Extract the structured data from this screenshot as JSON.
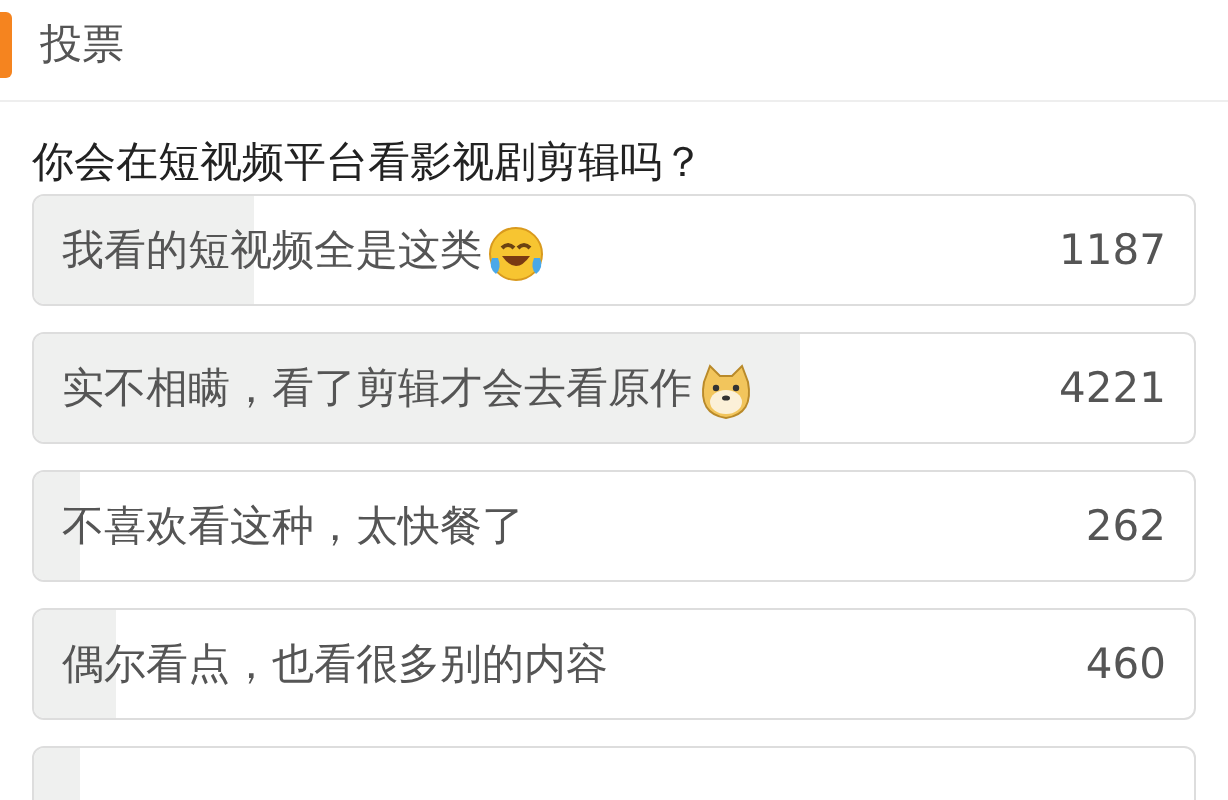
{
  "section": {
    "title": "投票"
  },
  "question": "你会在短视频平台看影视剧剪辑吗？",
  "options": [
    {
      "kind": "laughing",
      "label": "我看的短视频全是这类",
      "count": "1187",
      "level": 0.19
    },
    {
      "kind": "dog",
      "label": "实不相瞒，看了剪辑才会去看原作",
      "count": "4221",
      "level": 0.66
    },
    {
      "kind": "plain",
      "label": "不喜欢看这种，太快餐了",
      "count": "262",
      "level": 0.04
    },
    {
      "kind": "plain",
      "label": "偶尔看点，也看很多别的内容",
      "count": "460",
      "level": 0.07
    },
    {
      "kind": "plain",
      "level": 0.04
    }
  ]
}
